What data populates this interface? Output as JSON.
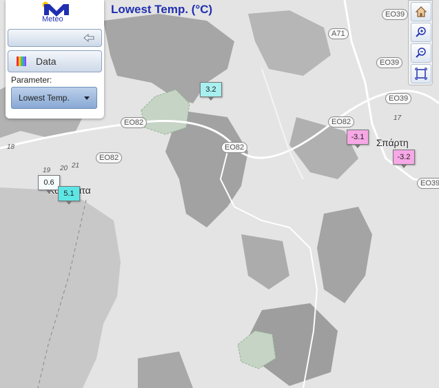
{
  "map_title": "Lowest Temp. (°C)",
  "logo": {
    "label": "Meteo",
    "brand_color": "#1f2fb0"
  },
  "panel": {
    "back_icon": "arrow-left-icon",
    "data_label": "Data",
    "parameter_label": "Parameter:",
    "parameter_value": "Lowest Temp."
  },
  "tools": [
    {
      "name": "home",
      "icon": "home-icon"
    },
    {
      "name": "zoom-in",
      "icon": "zoom-in-icon"
    },
    {
      "name": "zoom-out",
      "icon": "zoom-out-icon"
    },
    {
      "name": "fullscreen",
      "icon": "fullscreen-icon"
    }
  ],
  "roads": {
    "eo39_a": "EO39",
    "a71": "A71",
    "eo39_b": "EO39",
    "eo39_c": "EO39",
    "eo82_a": "EO82",
    "eo82_b": "EO82",
    "eo82_c": "EO82",
    "eo82_d": "EO82",
    "eo39_d": "EO39"
  },
  "cities": {
    "sparti": "Σπάρτη",
    "kalamata": "Καλαμάτα"
  },
  "map_numbers": {
    "n18": "18",
    "n19": "19",
    "n20": "20",
    "n21": "21",
    "n17": "17"
  },
  "stations": [
    {
      "value": "3.2",
      "color": "#a8f0f0"
    },
    {
      "value": "-3.1",
      "color": "#f7a8e6"
    },
    {
      "value": "-3.2",
      "color": "#f7a8e6"
    },
    {
      "value": "0.6",
      "color": "#f6fbfb"
    },
    {
      "value": "5.1",
      "color": "#5ee6e6"
    }
  ]
}
